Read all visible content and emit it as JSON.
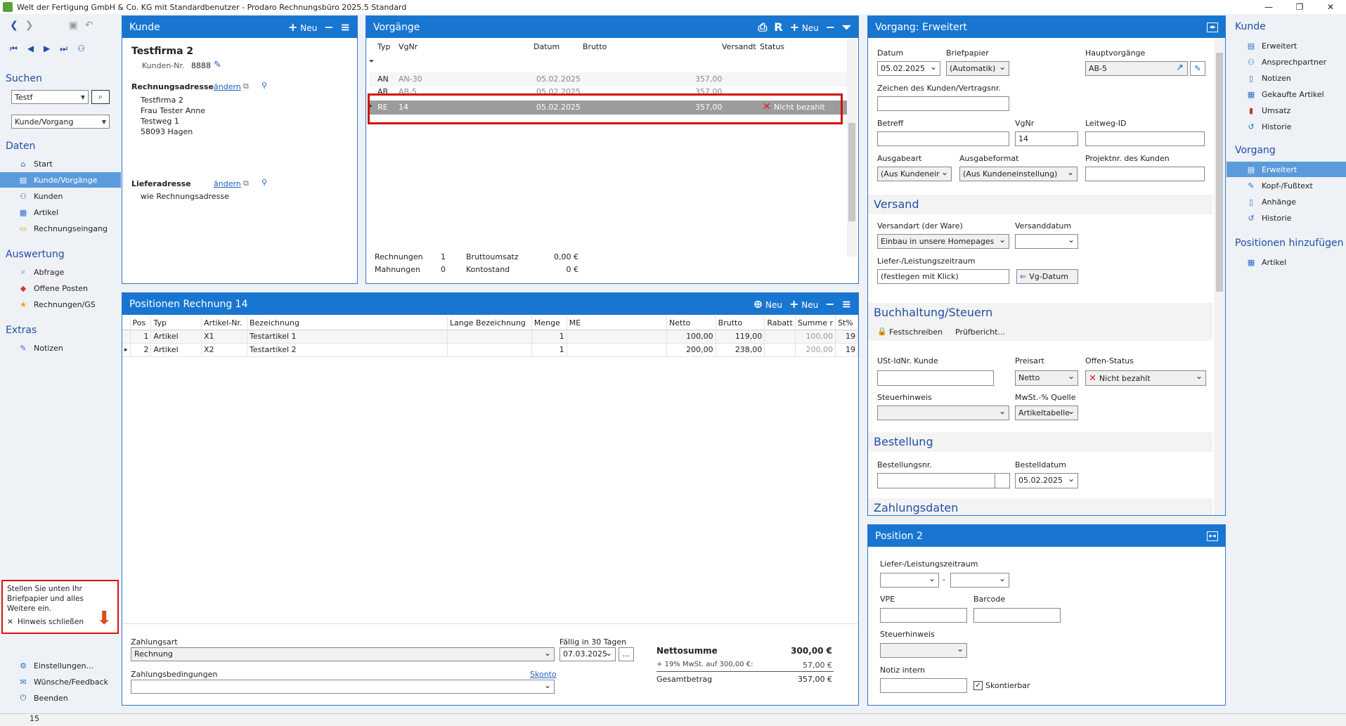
{
  "window": {
    "title": "Welt der Fertigung GmbH & Co. KG mit Standardbenutzer  -  Prodaro Rechnungsbüro 2025.5 Standard"
  },
  "left": {
    "search_h": "Suchen",
    "search_value": "Testf",
    "search_scope": "Kunde/Vorgang",
    "daten_h": "Daten",
    "daten": [
      "Start",
      "Kunde/Vorgänge",
      "Kunden",
      "Artikel",
      "Rechnungseingang"
    ],
    "auswertung_h": "Auswertung",
    "auswertung": [
      "Abfrage",
      "Offene Posten",
      "Rechnungen/GS"
    ],
    "extras_h": "Extras",
    "extras": [
      "Notizen"
    ],
    "hint_text": "Stellen Sie unten Ihr Briefpapier und alles Weitere ein.",
    "hint_close": "Hinweis schließen",
    "bottom": [
      "Einstellungen...",
      "Wünsche/Feedback",
      "Beenden"
    ]
  },
  "status": {
    "text": "15"
  },
  "kunde": {
    "header": "Kunde",
    "new": "Neu",
    "name": "Testfirma 2",
    "nr_label": "Kunden-Nr.",
    "nr": "8888",
    "rechnung_label": "Rechnungsadresse",
    "change": "ändern",
    "addr": [
      "Testfirma 2",
      "Frau Tester Anne",
      "Testweg 1",
      "58093 Hagen"
    ],
    "liefer_label": "Lieferadresse",
    "liefer_value": "wie Rechnungsadresse"
  },
  "vorgaenge": {
    "header": "Vorgänge",
    "new": "Neu",
    "r": "R",
    "cols": [
      "Typ",
      "VgNr",
      "Datum",
      "Brutto",
      "Versandt",
      "Status"
    ],
    "rows": [
      {
        "typ": "AN",
        "nr": "AN-30",
        "datum": "05.02.2025",
        "brutto": "357,00",
        "status": ""
      },
      {
        "typ": "AB",
        "nr": "AB-5",
        "datum": "05.02.2025",
        "brutto": "357,00",
        "status": ""
      },
      {
        "typ": "RE",
        "nr": "14",
        "datum": "05.02.2025",
        "brutto": "357,00",
        "status": "Nicht bezahlt"
      }
    ],
    "sum": {
      "rechnungen_l": "Rechnungen",
      "rechnungen": "1",
      "mahnungen_l": "Mahnungen",
      "mahnungen": "0",
      "umsatz_l": "Bruttoumsatz",
      "umsatz": "0,00 €",
      "konto_l": "Kontostand",
      "konto": "0 €"
    }
  },
  "positionen": {
    "header": "Positionen Rechnung 14",
    "new": "Neu",
    "cols": [
      "Pos",
      "Typ",
      "Artikel-Nr.",
      "Bezeichnung",
      "Lange Bezeichnung",
      "Menge",
      "ME",
      "Netto",
      "Brutto",
      "Rabatt",
      "Summe r",
      "St%"
    ],
    "rows": [
      {
        "pos": "1",
        "typ": "Artikel",
        "nr": "X1",
        "bez": "Testartikel 1",
        "lang": "",
        "menge": "1",
        "me": "",
        "netto": "100,00",
        "brutto": "119,00",
        "rabatt": "",
        "summe": "100,00",
        "st": "19"
      },
      {
        "pos": "2",
        "typ": "Artikel",
        "nr": "X2",
        "bez": "Testartikel 2",
        "lang": "",
        "menge": "1",
        "me": "",
        "netto": "200,00",
        "brutto": "238,00",
        "rabatt": "",
        "summe": "200,00",
        "st": "19"
      }
    ],
    "zahlungsart_l": "Zahlungsart",
    "zahlungsart": "Rechnung",
    "faellig_l": "Fällig in 30 Tagen",
    "faellig": "07.03.2025",
    "dots": "...",
    "bedingungen_l": "Zahlungsbedingungen",
    "skonto": "Skonto",
    "netto_l": "Nettosumme",
    "netto": "300,00  €",
    "mwst_l": "+ 19% MwSt. auf 300,00 €:",
    "mwst": "57,00  €",
    "gesamt_l": "Gesamtbetrag",
    "gesamt": "357,00  €"
  },
  "vorgang": {
    "header": "Vorgang: Erweitert",
    "datum_l": "Datum",
    "datum": "05.02.2025",
    "brief_l": "Briefpapier",
    "brief": "(Automatik)",
    "haupt_l": "Hauptvorgänge",
    "haupt": "AB-5",
    "zeichen_l": "Zeichen des Kunden/Vertragsnr.",
    "betreff_l": "Betreff",
    "vgnr_l": "VgNr",
    "vgnr": "14",
    "leitweg_l": "Leitweg-ID",
    "ausgabeart_l": "Ausgabeart",
    "ausgabeart": "(Aus Kundeneir",
    "ausgabeformat_l": "Ausgabeformat",
    "ausgabeformat": "(Aus Kundeneinstellung)",
    "projekt_l": "Projektnr. des Kunden",
    "versand_h": "Versand",
    "versandart_l": "Versandart (der Ware)",
    "versandart": "Einbau in unsere Homepages",
    "versanddatum_l": "Versanddatum",
    "zeitraum_l": "Liefer-/Leistungszeitraum",
    "zeitraum": "(festlegen mit Klick)",
    "vgdatum": "Vg-Datum",
    "buch_h": "Buchhaltung/Steuern",
    "fest": "Festschreiben",
    "pruef": "Prüfbericht...",
    "ust_l": "USt-IdNr. Kunde",
    "preisart_l": "Preisart",
    "preisart": "Netto",
    "offen_l": "Offen-Status",
    "offen": "Nicht bezahlt",
    "steuer_l": "Steuerhinweis",
    "mwstq_l": "MwSt.-% Quelle",
    "mwstq": "Artikeltabelle",
    "bestell_h": "Bestellung",
    "bestellnr_l": "Bestellungsnr.",
    "bestelldatum_l": "Bestelldatum",
    "bestelldatum": "05.02.2025",
    "zahl_h": "Zahlungsdaten"
  },
  "position2": {
    "header": "Position 2",
    "zeitraum_l": "Liefer-/Leistungszeitraum",
    "dash": "-",
    "vpe_l": "VPE",
    "barcode_l": "Barcode",
    "steuer_l": "Steuerhinweis",
    "notiz_l": "Notiz intern",
    "skonto_l": "Skontierbar"
  },
  "right": {
    "kunde_h": "Kunde",
    "kunde": [
      "Erweitert",
      "Ansprechpartner",
      "Notizen",
      "Gekaufte Artikel",
      "Umsatz",
      "Historie"
    ],
    "vorgang_h": "Vorgang",
    "vorgang": [
      "Erweitert",
      "Kopf-/Fußtext",
      "Anhänge",
      "Historie"
    ],
    "pos_h": "Positionen hinzufügen",
    "pos": [
      "Artikel"
    ]
  },
  "colors": {
    "accent": "#1876d1",
    "highlight": "#d11111",
    "selected_nav": "#5b9bdc"
  }
}
